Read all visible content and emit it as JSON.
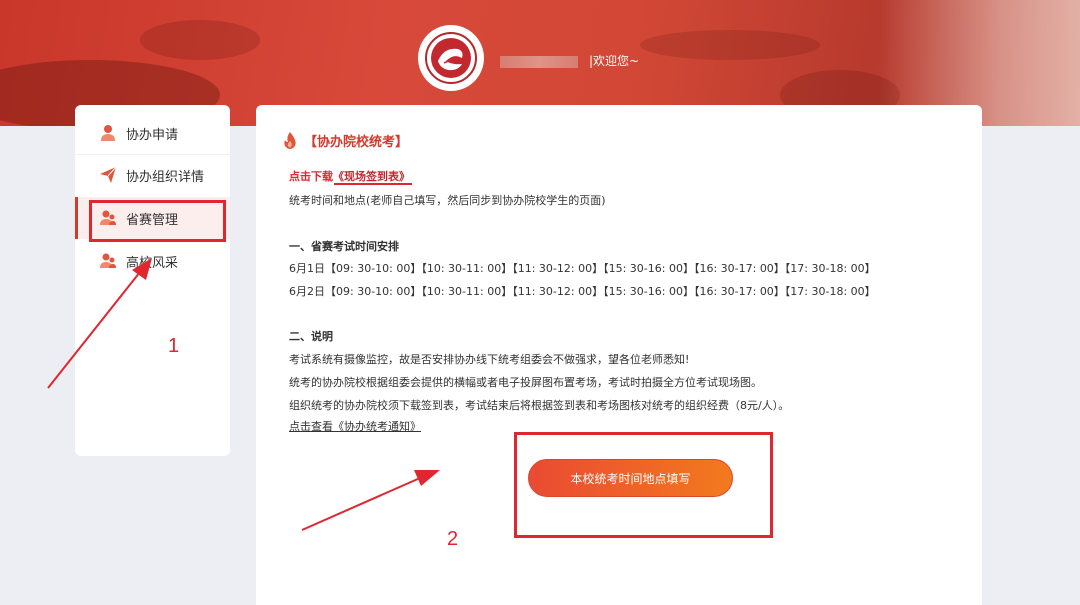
{
  "header": {
    "welcome_text": "|欢迎您~",
    "logo_name": "school-seal-logo"
  },
  "sidebar": {
    "items": [
      {
        "label": "协办申请",
        "icon": "user-icon",
        "active": false
      },
      {
        "label": "协办组织详情",
        "icon": "paper-plane-icon",
        "active": false
      },
      {
        "label": "省赛管理",
        "icon": "user-group-icon",
        "active": true
      },
      {
        "label": "高校风采",
        "icon": "user-group-icon",
        "active": false
      }
    ]
  },
  "main": {
    "section_title": "【协办院校统考】",
    "download_prefix": "点击下载",
    "download_link": "《现场签到表》",
    "intro": "统考时间和地点(老师自己填写，然后同步到协办院校学生的页面)",
    "schedule_heading": "一、省赛考试时间安排",
    "schedule_rows": [
      "6月1日【09: 30-10: 00】【10: 30-11: 00】【11: 30-12: 00】【15: 30-16: 00】【16: 30-17: 00】【17: 30-18: 00】",
      "6月2日【09: 30-10: 00】【10: 30-11: 00】【11: 30-12: 00】【15: 30-16: 00】【16: 30-17: 00】【17: 30-18: 00】"
    ],
    "notes_heading": "二、说明",
    "notes": [
      "考试系统有摄像监控，故是否安排协办线下统考组委会不做强求，望各位老师悉知!",
      "统考的协办院校根据组委会提供的横幅或者电子投屏图布置考场，考试时拍摄全方位考试现场图。",
      "组织统考的协办院校须下载签到表，考试结束后将根据签到表和考场图核对统考的组织经费（8元/人）。"
    ],
    "notice_link": "点击查看《协办统考通知》",
    "fill_button": "本校统考时间地点填写"
  },
  "annotations": {
    "step1": "1",
    "step2": "2",
    "color": "#e0262e"
  },
  "colors": {
    "brand_red": "#d23a2c",
    "button_start": "#ea4a32",
    "button_end": "#f27a1e"
  }
}
